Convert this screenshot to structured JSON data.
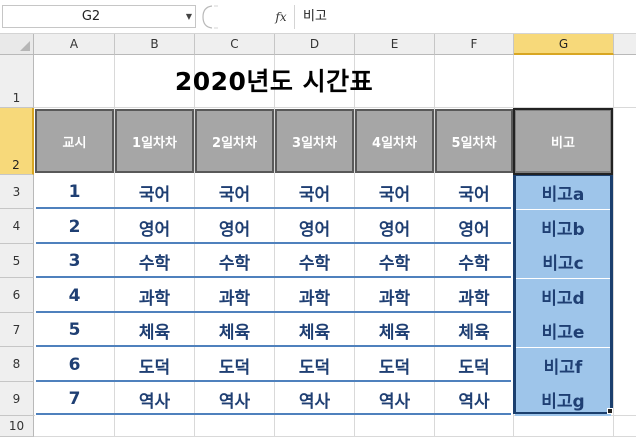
{
  "formula_bar": {
    "name_box": "G2",
    "fx_label": "fx",
    "formula": "비고"
  },
  "columns": [
    "A",
    "B",
    "C",
    "D",
    "E",
    "F",
    "G"
  ],
  "rows": [
    "1",
    "2",
    "3",
    "4",
    "5",
    "6",
    "7",
    "8",
    "9",
    "10"
  ],
  "sheet": {
    "title": "2020년도 시간표",
    "header": [
      "교시",
      "1일차차",
      "2일차차",
      "3일차차",
      "4일차차",
      "5일차차",
      "비고"
    ],
    "body": [
      [
        "1",
        "국어",
        "국어",
        "국어",
        "국어",
        "국어",
        "비고a"
      ],
      [
        "2",
        "영어",
        "영어",
        "영어",
        "영어",
        "영어",
        "비고b"
      ],
      [
        "3",
        "수학",
        "수학",
        "수학",
        "수학",
        "수학",
        "비고c"
      ],
      [
        "4",
        "과학",
        "과학",
        "과학",
        "과학",
        "과학",
        "비고d"
      ],
      [
        "5",
        "체육",
        "체육",
        "체육",
        "체육",
        "체육",
        "비고e"
      ],
      [
        "6",
        "도덕",
        "도덕",
        "도덕",
        "도덕",
        "도덕",
        "비고f"
      ],
      [
        "7",
        "역사",
        "역사",
        "역사",
        "역사",
        "역사",
        "비고g"
      ]
    ]
  },
  "colors": {
    "header_fill": "#a6a6a6",
    "data_text": "#1f3f73",
    "row_line": "#4f81bd",
    "note_fill": "#9ec5ea",
    "selection_header": "#f7d97a"
  }
}
